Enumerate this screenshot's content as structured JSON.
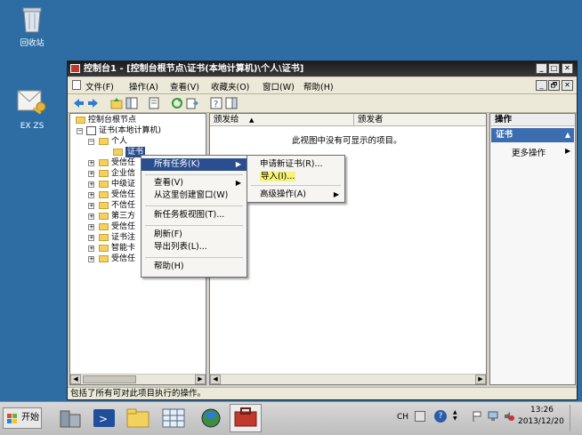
{
  "desktop": {
    "recycle_bin_label": "回收站",
    "user_icon_label": "EX ZS"
  },
  "window": {
    "title": "控制台1 - [控制台根节点\\证书(本地计算机)\\个人\\证书]",
    "controls": [
      "_",
      "□",
      "✕"
    ],
    "inner_controls": [
      "_",
      "🗗",
      "✕"
    ]
  },
  "menubar": {
    "items": [
      "文件(F)",
      "操作(A)",
      "查看(V)",
      "收藏夹(O)",
      "窗口(W)",
      "帮助(H)"
    ]
  },
  "tree": {
    "rows": [
      {
        "label": "控制台根节点"
      },
      {
        "label": "证书(本地计算机)"
      },
      {
        "label": "个人"
      },
      {
        "label": "证书"
      },
      {
        "label": "受信任"
      },
      {
        "label": "企业信"
      },
      {
        "label": "中级证"
      },
      {
        "label": "受信任"
      },
      {
        "label": "不信任"
      },
      {
        "label": "第三方"
      },
      {
        "label": "受信任"
      },
      {
        "label": "证书注"
      },
      {
        "label": "智能卡"
      },
      {
        "label": "受信任"
      }
    ]
  },
  "list": {
    "columns": [
      "颁发给",
      "颁发者"
    ],
    "empty_message": "此视图中没有可显示的项目。"
  },
  "context_menu": {
    "items": [
      "所有任务(K)",
      "查看(V)",
      "从这里创建窗口(W)",
      "新任务板视图(T)...",
      "刷新(F)",
      "导出列表(L)...",
      "帮助(H)"
    ]
  },
  "submenu": {
    "items": [
      "申请新证书(R)...",
      "导入(I)...",
      "高级操作(A)"
    ]
  },
  "actions": {
    "title": "操作",
    "section": "证书",
    "more": "更多操作"
  },
  "status": {
    "text": "包括了所有可对此项目执行的操作。"
  },
  "taskbar": {
    "start_label": "开始",
    "lang": "CH",
    "time": "13:26",
    "date": "2013/12/20"
  },
  "colors": {
    "desktop": "#2E6DA4",
    "highlight": "#2A4E8F",
    "yellow_highlight": "#F6F37A",
    "actions_section": "#3C6DB0"
  }
}
